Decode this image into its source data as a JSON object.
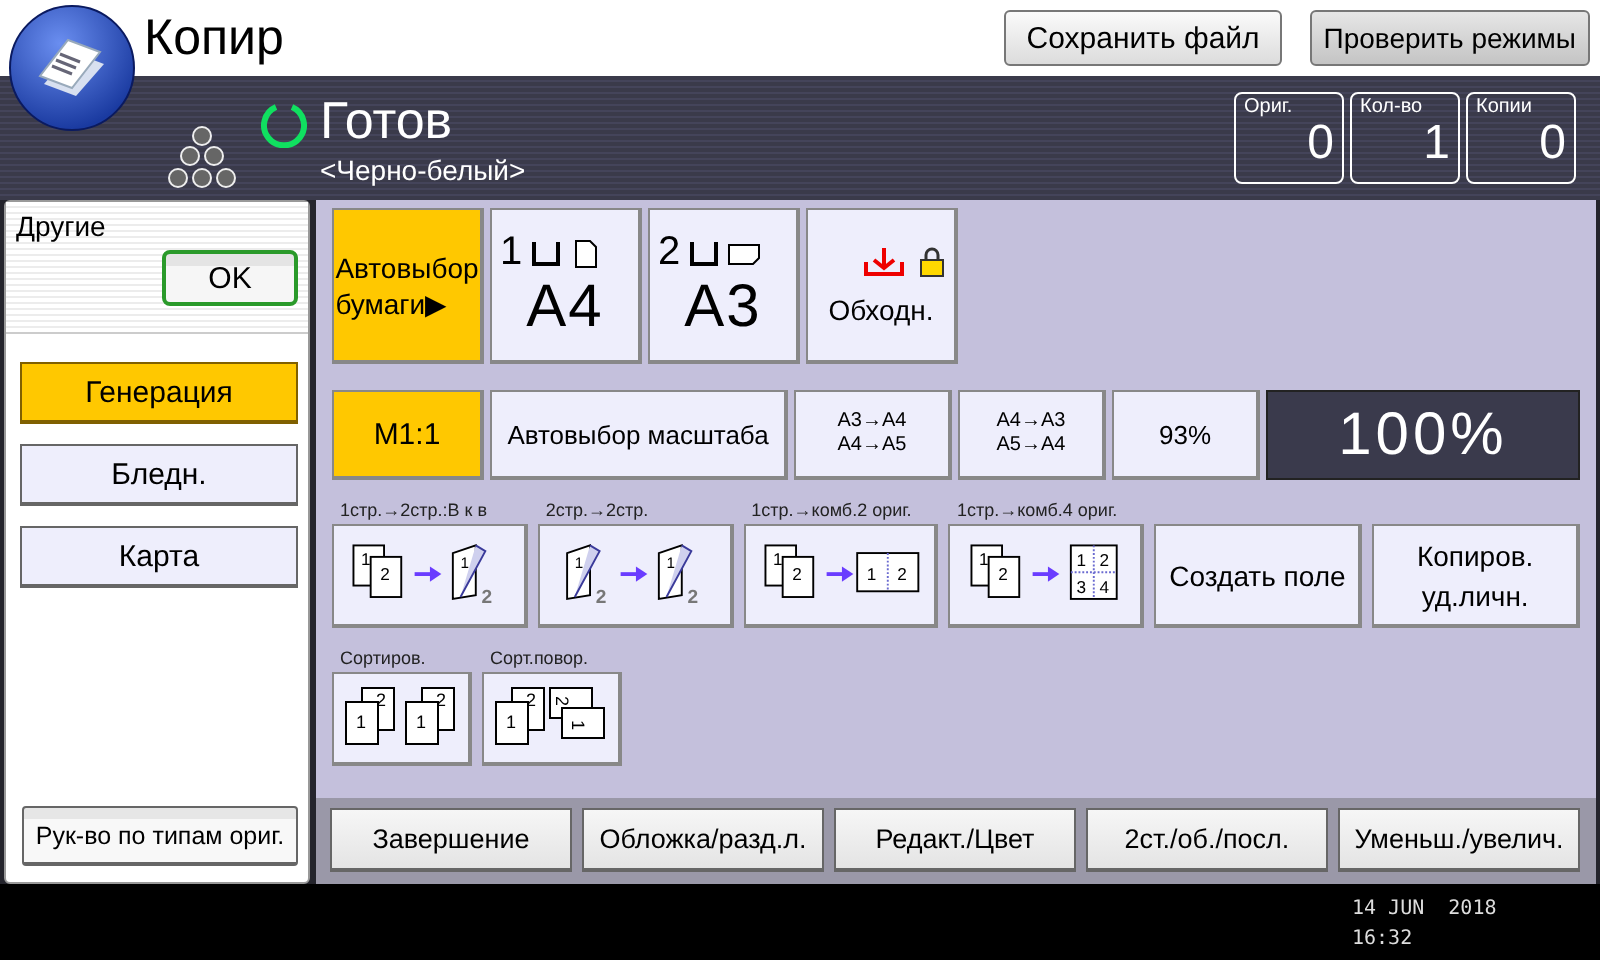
{
  "header": {
    "title": "Копир",
    "buttons": [
      "Сохранить файл",
      "Проверить режимы"
    ]
  },
  "status": {
    "state": "Готов",
    "mode": "<Черно-белый>",
    "counters": [
      {
        "label": "Ориг.",
        "value": "0"
      },
      {
        "label": "Кол-во",
        "value": "1"
      },
      {
        "label": "Копии",
        "value": "0"
      }
    ]
  },
  "sidebar": {
    "title": "Другие",
    "ok": "OK",
    "items": [
      {
        "label": "Генерация",
        "selected": true
      },
      {
        "label": "Бледн.",
        "selected": false
      },
      {
        "label": "Карта",
        "selected": false
      }
    ],
    "guide": "Рук-во по типам ориг."
  },
  "paper": [
    {
      "kind": "auto",
      "label": "Автовыбор бумаги▶",
      "selected": true
    },
    {
      "kind": "tray_portrait",
      "tray": "1",
      "size": "A4",
      "selected": false
    },
    {
      "kind": "tray_landscape",
      "tray": "2",
      "size": "A3",
      "selected": false
    },
    {
      "kind": "bypass",
      "label": "Обходн.",
      "selected": false
    }
  ],
  "ratio": [
    {
      "kind": "text",
      "label": "M1:1",
      "selected": true
    },
    {
      "kind": "text",
      "label": "Автовыбор масштаба",
      "selected": false
    },
    {
      "kind": "pair",
      "lines": [
        "A3→A4",
        "A4→A5"
      ],
      "selected": false
    },
    {
      "kind": "pair",
      "lines": [
        "A4→A3",
        "A5→A4"
      ],
      "selected": false
    },
    {
      "kind": "text",
      "label": "93%",
      "selected": false
    }
  ],
  "ratio_display": "100%",
  "layout_options": [
    {
      "caption": "1стр.→2стр.:В к в",
      "from": {
        "kind": "stack",
        "digits": [
          "1",
          "2"
        ]
      },
      "to": {
        "kind": "flip",
        "digits": [
          "1",
          "2"
        ]
      }
    },
    {
      "caption": "2стр.→2стр.",
      "from": {
        "kind": "flip",
        "digits": [
          "1",
          "2"
        ]
      },
      "to": {
        "kind": "flip",
        "digits": [
          "1",
          "2"
        ]
      }
    },
    {
      "caption": "1стр.→комб.2 ориг.",
      "from": {
        "kind": "stack",
        "digits": [
          "1",
          "2"
        ]
      },
      "to": {
        "kind": "grid2",
        "digits": [
          "1",
          "2"
        ]
      }
    },
    {
      "caption": "1стр.→комб.4 ориг.",
      "from": {
        "kind": "stack",
        "digits": [
          "1",
          "2"
        ]
      },
      "to": {
        "kind": "grid4",
        "digits": [
          "1",
          "2",
          "3",
          "4"
        ]
      }
    }
  ],
  "text_buttons": [
    "Создать поле",
    "Копиров. уд.личн."
  ],
  "sort_options": [
    {
      "caption": "Сортиров.",
      "kind": "sort",
      "digits": [
        "1",
        "2",
        "1",
        "2"
      ]
    },
    {
      "caption": "Сорт.повор.",
      "kind": "rotate",
      "digits": [
        "1",
        "2",
        "2",
        "1"
      ]
    }
  ],
  "bottom_tabs": [
    "Завершение",
    "Обложка/разд.л.",
    "Редакт./Цвет",
    "2ст./об./посл.",
    "Уменьш./увелич."
  ],
  "clock": {
    "date": "14 JUN  2018",
    "time": "16:32"
  }
}
